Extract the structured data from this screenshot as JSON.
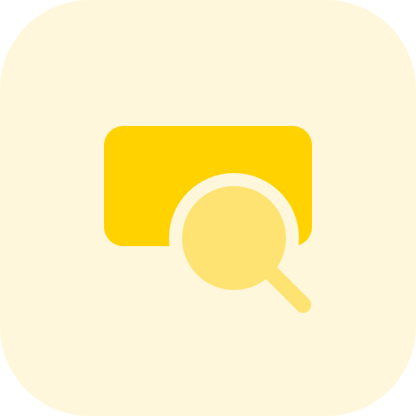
{
  "icon": {
    "name": "search-window-icon",
    "colors": {
      "background": "#FFF7DC",
      "window": "#FFD200",
      "lens": "#FFE372",
      "handle": "#FFE372"
    }
  }
}
